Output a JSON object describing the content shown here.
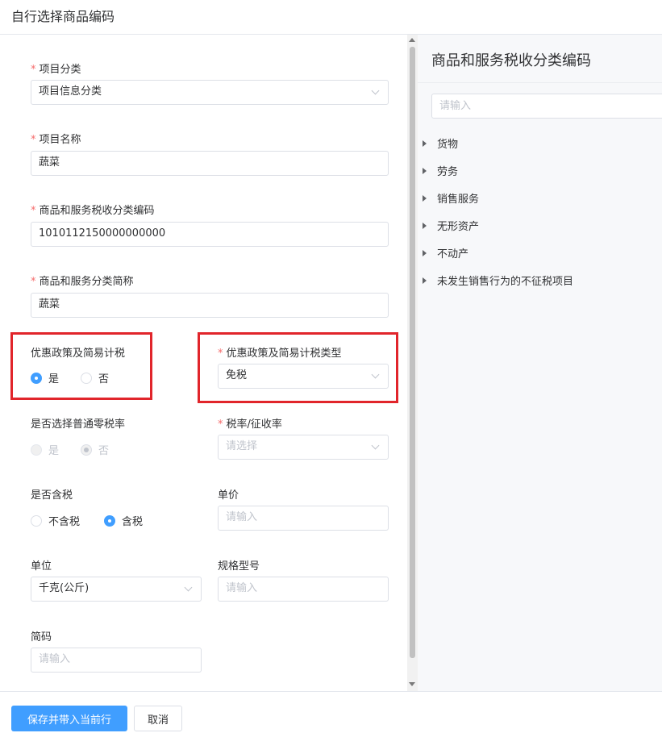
{
  "dialog": {
    "title": "自行选择商品编码"
  },
  "form": {
    "project_category": {
      "label": "项目分类",
      "value": "项目信息分类"
    },
    "project_name": {
      "label": "项目名称",
      "value": "蔬菜"
    },
    "tax_code": {
      "label": "商品和服务税收分类编码",
      "value": "1010112150000000000"
    },
    "short_name": {
      "label": "商品和服务分类简称",
      "value": "蔬菜"
    },
    "preferential_policy": {
      "label": "优惠政策及简易计税",
      "options": [
        "是",
        "否"
      ],
      "selected": "是"
    },
    "preferential_type": {
      "label": "优惠政策及简易计税类型",
      "value": "免税"
    },
    "zero_rate": {
      "label": "是否选择普通零税率",
      "options": [
        "是",
        "否"
      ],
      "selected": "否",
      "disabled": true
    },
    "tax_rate": {
      "label": "税率/征收率",
      "placeholder": "请选择"
    },
    "tax_included": {
      "label": "是否含税",
      "options": [
        "不含税",
        "含税"
      ],
      "selected": "含税"
    },
    "unit_price": {
      "label": "单价",
      "placeholder": "请输入"
    },
    "unit": {
      "label": "单位",
      "value": "千克(公斤)"
    },
    "spec_model": {
      "label": "规格型号",
      "placeholder": "请输入"
    },
    "short_code": {
      "label": "简码",
      "placeholder": "请输入"
    },
    "required_mark": "*"
  },
  "tree_panel": {
    "title": "商品和服务税收分类编码",
    "search_placeholder": "请输入",
    "items": [
      "货物",
      "劳务",
      "销售服务",
      "无形资产",
      "不动产",
      "未发生销售行为的不征税项目"
    ]
  },
  "footer": {
    "save_label": "保存并带入当前行",
    "cancel_label": "取消"
  },
  "colors": {
    "primary": "#409eff",
    "required": "#f56c6c",
    "highlight_box": "#e1252b"
  }
}
